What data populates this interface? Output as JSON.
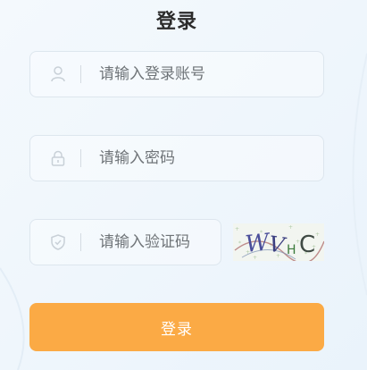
{
  "login": {
    "title": "登录",
    "account_placeholder": "请输入登录账号",
    "password_placeholder": "请输入密码",
    "captcha_placeholder": "请输入验证码",
    "captcha_text": "WVHC",
    "submit_label": "登录"
  },
  "icons": {
    "account": "user-icon",
    "password": "lock-icon",
    "captcha": "shield-icon"
  },
  "colors": {
    "background": "#eef5fb",
    "button": "#fbaa45",
    "button_text": "#ffffff",
    "field_border": "#dde6ee",
    "placeholder": "#6f7478",
    "title": "#2b2b2b"
  }
}
